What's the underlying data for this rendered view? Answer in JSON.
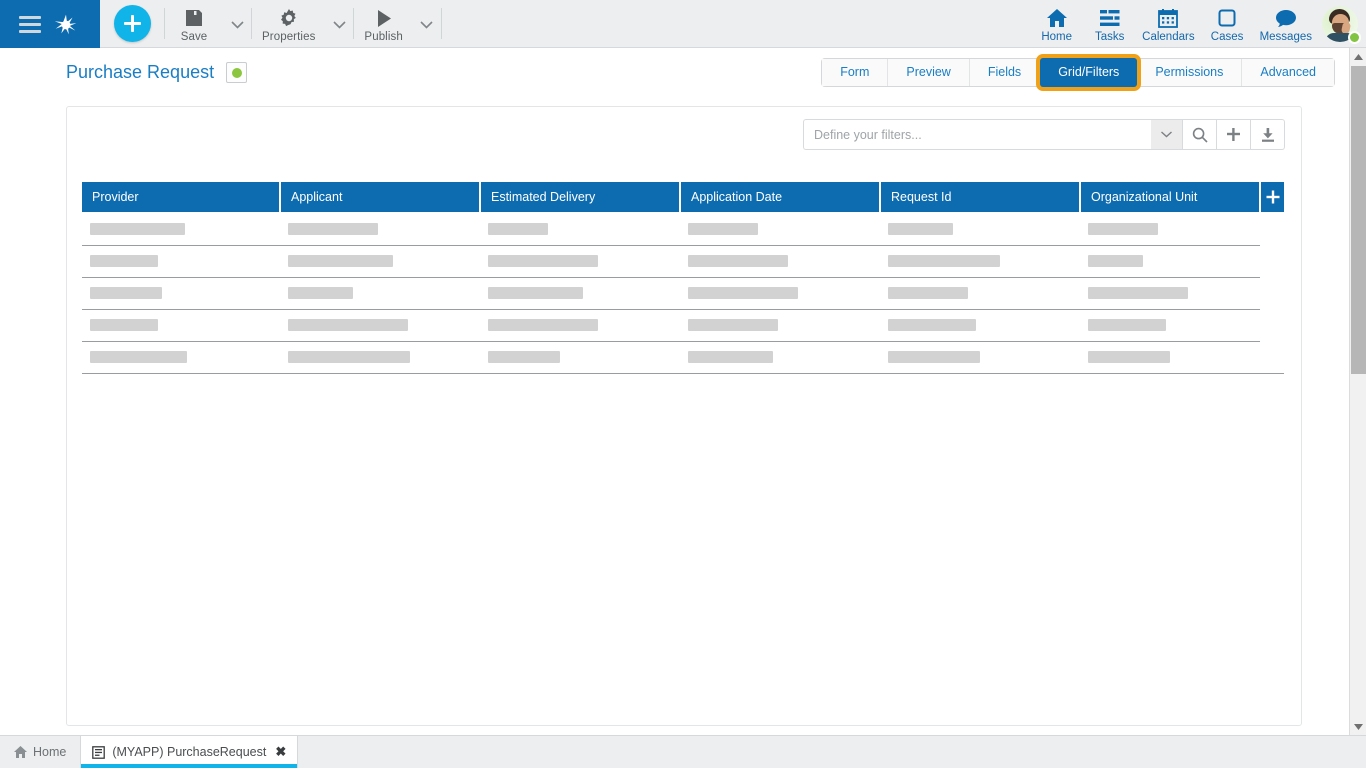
{
  "topbar": {
    "menu_icon": "hamburger-icon",
    "logo_icon": "bizagi-logo-icon",
    "add_button_label": "+",
    "tools": [
      {
        "label": "Save",
        "icon": "save-floppy-icon",
        "has_caret": true
      },
      {
        "label": "Properties",
        "icon": "gear-icon",
        "has_caret": true
      },
      {
        "label": "Publish",
        "icon": "play-triangle-icon",
        "has_caret": true
      }
    ],
    "nav": [
      {
        "label": "Home",
        "icon": "home-icon"
      },
      {
        "label": "Tasks",
        "icon": "tasks-list-icon"
      },
      {
        "label": "Calendars",
        "icon": "calendar-icon"
      },
      {
        "label": "Cases",
        "icon": "cases-square-icon"
      },
      {
        "label": "Messages",
        "icon": "message-bubble-icon"
      }
    ],
    "avatar": {
      "name": "user-avatar",
      "status": "online"
    }
  },
  "page": {
    "title": "Purchase Request",
    "status_color": "#8cc63e",
    "tabs": [
      {
        "label": "Form",
        "active": false
      },
      {
        "label": "Preview",
        "active": false
      },
      {
        "label": "Fields",
        "active": false
      },
      {
        "label": "Grid/Filters",
        "active": true
      },
      {
        "label": "Permissions",
        "active": false
      },
      {
        "label": "Advanced",
        "active": false
      }
    ],
    "highlight_color": "#f0a11a",
    "accent_color": "#0d6bb0"
  },
  "filters": {
    "placeholder": "Define your filters...",
    "value": "",
    "buttons": [
      {
        "name": "filter-dropdown-button",
        "icon": "chevron-down-icon"
      },
      {
        "name": "search-button",
        "icon": "search-icon"
      },
      {
        "name": "add-filter-button",
        "icon": "plus-icon"
      },
      {
        "name": "export-button",
        "icon": "download-icon"
      }
    ]
  },
  "grid": {
    "columns": [
      "Provider",
      "Applicant",
      "Estimated Delivery",
      "Application Date",
      "Request Id",
      "Organizational Unit"
    ],
    "add_column_label": "+",
    "placeholder_rows": [
      [
        95,
        90,
        60,
        70,
        65,
        70
      ],
      [
        68,
        105,
        110,
        100,
        112,
        55
      ],
      [
        72,
        65,
        95,
        110,
        80,
        100
      ],
      [
        68,
        120,
        110,
        90,
        88,
        78
      ],
      [
        97,
        122,
        72,
        85,
        92,
        82
      ]
    ]
  },
  "taskbar": {
    "home_label": "Home",
    "home_icon": "home-icon",
    "tab_label": "(MYAPP) PurchaseRequest",
    "tab_icon": "document-icon",
    "tab_close": "✖"
  },
  "scrollbar": {
    "up_icon": "triangle-up-icon",
    "down_icon": "triangle-down-icon"
  }
}
